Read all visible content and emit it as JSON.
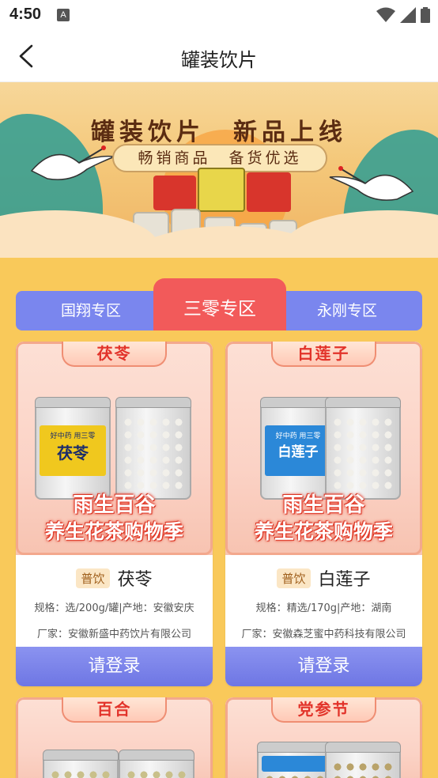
{
  "status": {
    "time": "4:50",
    "notif_icon": "A"
  },
  "header": {
    "title": "罐装饮片"
  },
  "banner": {
    "headline": "罐装饮片　新品上线",
    "subline": "畅销商品　备货优选"
  },
  "tabs": {
    "left": "国翔专区",
    "active": "三零专区",
    "right": "永刚专区"
  },
  "products": [
    {
      "ribbon": "茯苓",
      "jar_label": "茯苓",
      "jar_tagline": "好中药 用三零",
      "promo_line1": "雨生百谷",
      "promo_line2": "养生花茶购物季",
      "badge": "普饮",
      "name": "茯苓",
      "spec": "规格：选/200g/罐|产地：安徽安庆",
      "maker": "厂家：安徽新盛中药饮片有限公司",
      "button": "请登录",
      "label_color": "#f0c81e"
    },
    {
      "ribbon": "白莲子",
      "jar_label": "白莲子",
      "jar_tagline": "好中药 用三零",
      "promo_line1": "雨生百谷",
      "promo_line2": "养生花茶购物季",
      "badge": "普饮",
      "name": "白莲子",
      "spec": "规格：精选/170g|产地：湖南",
      "maker": "厂家：安徽森芝蜜中药科技有限公司",
      "button": "请登录",
      "label_color": "#2b88d8"
    },
    {
      "ribbon": "百合"
    },
    {
      "ribbon": "党参节"
    }
  ]
}
